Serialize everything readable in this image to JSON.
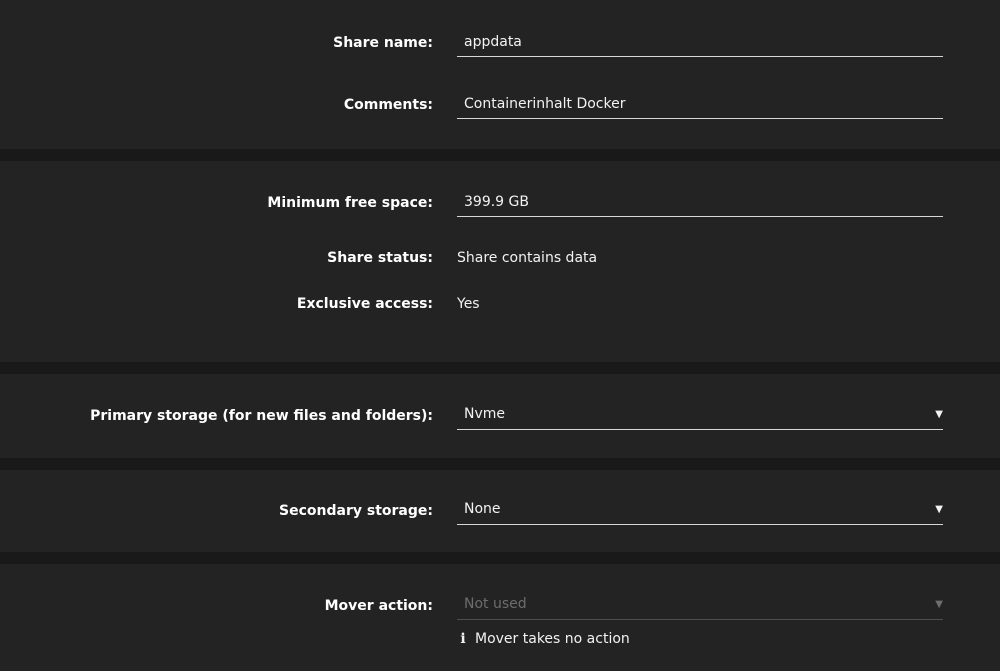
{
  "share": {
    "name_label": "Share name:",
    "name_value": "appdata",
    "comments_label": "Comments:",
    "comments_value": "Containerinhalt Docker"
  },
  "space": {
    "min_free_label": "Minimum free space:",
    "min_free_value": "399.9 GB",
    "status_label": "Share status:",
    "status_value": "Share contains data",
    "exclusive_label": "Exclusive access:",
    "exclusive_value": "Yes"
  },
  "primary": {
    "label": "Primary storage (for new files and folders):",
    "value": "Nvme"
  },
  "secondary": {
    "label": "Secondary storage:",
    "value": "None"
  },
  "mover": {
    "label": "Mover action:",
    "value": "Not used",
    "info_text": "Mover takes no action"
  },
  "icons": {
    "dropdown": "triangle-down-icon",
    "info": "info-icon"
  }
}
